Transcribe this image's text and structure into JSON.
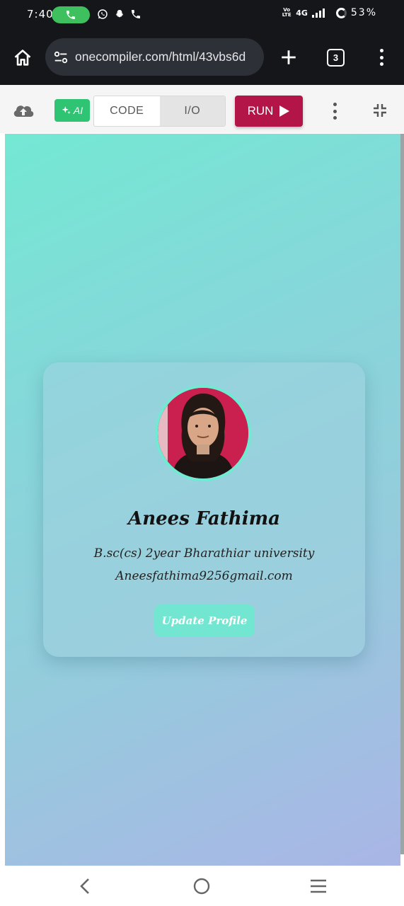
{
  "status_bar": {
    "time": "7:40",
    "network": "4G",
    "volte": "Vo LTE",
    "battery": "53%",
    "icons": [
      "call-active-icon",
      "whatsapp-icon",
      "snapchat-icon",
      "phone-icon",
      "signal-icon",
      "battery-icon"
    ]
  },
  "browser": {
    "url": "onecompiler.com/html/43vbs6d",
    "tab_count": "3",
    "icons": [
      "home-icon",
      "site-settings-icon",
      "new-tab-icon",
      "tabs-icon",
      "more-options-icon"
    ]
  },
  "toolbar": {
    "ai_label": "AI",
    "tabs": [
      {
        "label": "CODE",
        "active": false
      },
      {
        "label": "I/O",
        "active": true
      }
    ],
    "run_label": "RUN",
    "run_color": "#b31549",
    "ai_color": "#2ec473",
    "icons": [
      "cloud-upload-icon",
      "sparkle-icon",
      "play-icon",
      "more-icon",
      "collapse-icon"
    ]
  },
  "profile": {
    "name": "Anees Fathima",
    "education": "B.sc(cs) 2year Bharathiar university",
    "email": "Aneesfathima9256gmail.com",
    "button_label": "Update Profile",
    "accent_color": "#72e6d0"
  },
  "nav": {
    "icons": [
      "back-icon",
      "home-circle-icon",
      "recents-icon"
    ]
  }
}
